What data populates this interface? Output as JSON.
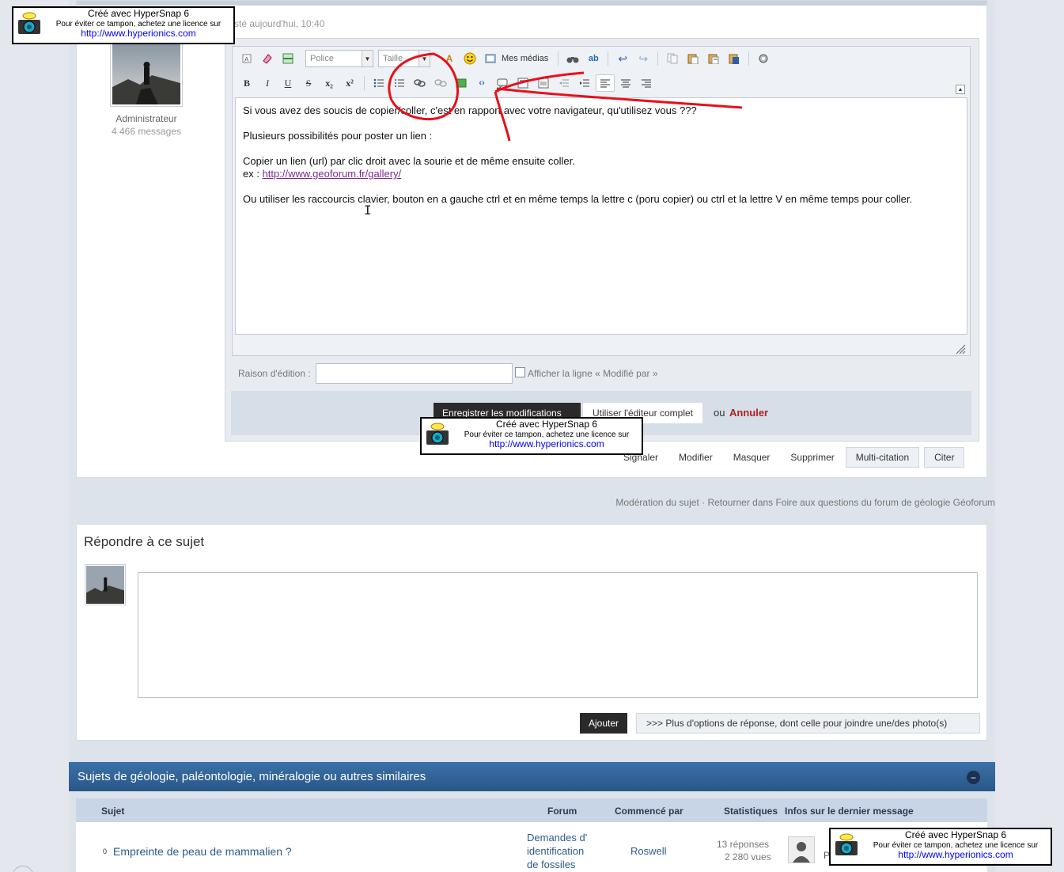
{
  "post": {
    "date_fragment": "sté aujourd'hui, 10:40",
    "user_role": "Administrateur",
    "user_messages": "4 466 messages"
  },
  "toolbar": {
    "font_placeholder": "Police",
    "size_placeholder": "Taille",
    "media_label": "Mes médias",
    "bold": "B",
    "italic": "I",
    "underline": "U",
    "strike": "S",
    "subscript": "x₂",
    "superscript": "x²"
  },
  "editor": {
    "line1": "Si vous avez des soucis de copier/coller, c'est en rapport avec votre navigateur, qu'utilisez vous ???",
    "line2": "Plusieurs possibilités pour poster un lien :",
    "line3": "Copier un lien (url) par clic droit avec la sourie et de même ensuite coller.",
    "line4_prefix": "ex : ",
    "line4_link": "http://www.geoforum.fr/gallery/",
    "line5": "Ou utiliser les raccourcis clavier, bouton en a gauche ctrl et en même temps la lettre c (poru copier) ou ctrl et la lettre V en même temps pour coller."
  },
  "edit_form": {
    "reason_label": "Raison d'édition :",
    "reason_value": "",
    "show_modified_label": "Afficher la ligne « Modifié par »",
    "save_label": "Enregistrer les modifications",
    "full_editor_label": "Utiliser l'éditeur complet",
    "or_label": "ou",
    "cancel_label": "Annuler"
  },
  "post_actions": {
    "report": "Signaler",
    "edit": "Modifier",
    "hide": "Masquer",
    "delete": "Supprimer",
    "multiquote": "Multi-citation",
    "quote": "Citer"
  },
  "topic_links": {
    "moderation": "Modération du sujet",
    "separator": " · ",
    "back": "Retourner dans Foire aux questions du forum de géologie Géoforum"
  },
  "reply": {
    "title": "Répondre à ce sujet",
    "textarea_value": "",
    "add_label": "Ajouter",
    "more_options_label": ">>> Plus d'options de réponse, dont celle pour joindre une/des photo(s)"
  },
  "similar": {
    "title": "Sujets de géologie, paléontologie, minéralogie ou autres similaires",
    "columns": {
      "subject": "Sujet",
      "forum": "Forum",
      "started_by": "Commencé par",
      "stats": "Statistiques",
      "last_info": "Infos sur le dernier message"
    },
    "rows": [
      {
        "subject": "Empreinte de peau de mammalien ?",
        "forum_l1": "Demandes d'",
        "forum_l2": "identification",
        "forum_l3": "de fossiles",
        "started_by": "Roswell",
        "replies": "13 réponses",
        "views": "2 280 vues",
        "last_fragment": "P"
      }
    ]
  },
  "watermark": {
    "line1": "Créé avec HyperSnap 6",
    "line2": "Pour éviter ce tampon, achetez une licence sur",
    "line3": "http://www.hyperionics.com"
  },
  "colors": {
    "annotation_red": "#e8101a",
    "section_header": "#2f6196",
    "cancel_red": "#b02020",
    "save_btn": "#2a2a2a"
  }
}
